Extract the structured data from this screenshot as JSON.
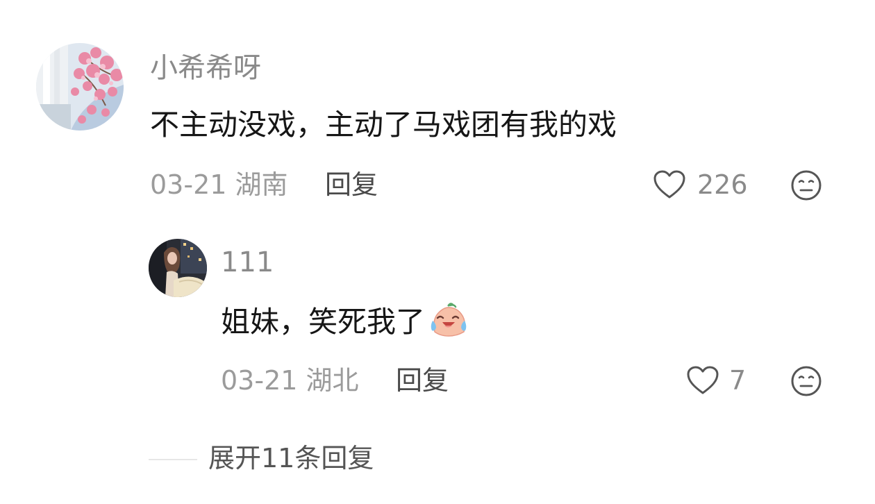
{
  "comment": {
    "username": "小希希呀",
    "text": "不主动没戏，主动了马戏团有我的戏",
    "date": "03-21",
    "location": "湖南",
    "reply_label": "回复",
    "like_count": "226",
    "like_icon": "heart-outline-icon",
    "dislike_icon": "meh-face-icon"
  },
  "reply": {
    "username": "111",
    "text": "姐妹，笑死我了",
    "emoji": "laugh-cry-emoji",
    "date": "03-21",
    "location": "湖北",
    "reply_label": "回复",
    "like_count": "7",
    "like_icon": "heart-outline-icon",
    "dislike_icon": "meh-face-icon"
  },
  "expand": {
    "label": "展开11条回复"
  },
  "colors": {
    "username": "#8a8a8a",
    "text": "#161616",
    "meta": "#9b9b9b",
    "action": "#4a4a4a"
  }
}
